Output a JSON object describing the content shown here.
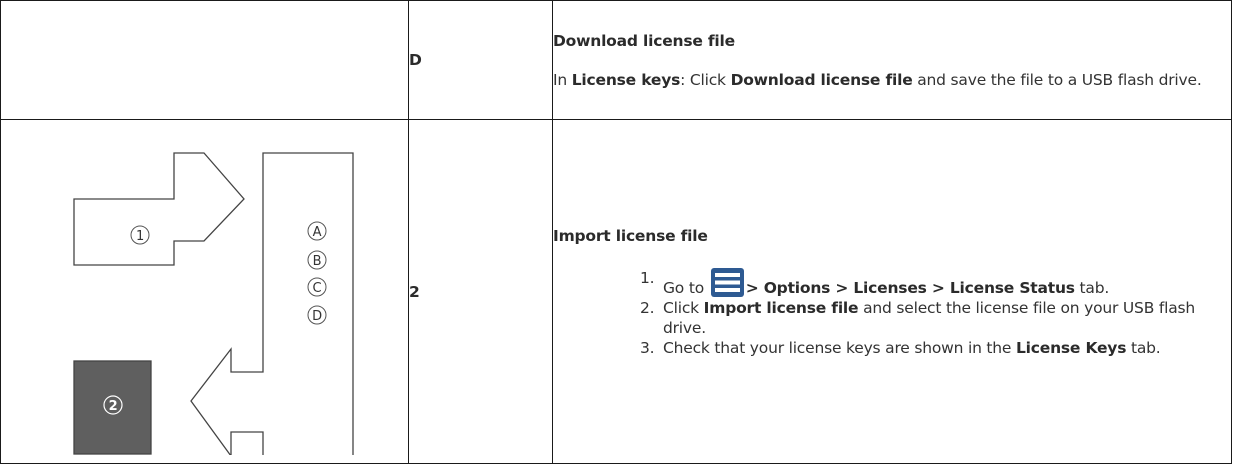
{
  "row_d": {
    "step_label": "D",
    "heading": "Download license file",
    "text_prefix": "In ",
    "text_bold1": "License keys",
    "text_mid": ": Click ",
    "text_bold2": "Download license file",
    "text_suffix": " and save the file to a USB flash drive."
  },
  "row_2": {
    "step_label": "2",
    "heading": "Import license file",
    "steps": [
      {
        "num": "1.",
        "pre": "Go to ",
        "bold": "> Options > Licenses > License Status",
        "post": " tab."
      },
      {
        "num": "2.",
        "pre": "Click ",
        "bold": "Import license file",
        "post": " and select the license file on your USB flash drive."
      },
      {
        "num": "3.",
        "pre": "Check that your license keys are shown in the ",
        "bold": "License Keys",
        "post": " tab."
      }
    ]
  },
  "diagram": {
    "labels": [
      "1",
      "A",
      "B",
      "C",
      "D",
      "2"
    ]
  },
  "icons": {
    "menu": "hamburger-menu-icon"
  },
  "colors": {
    "menu_icon": "#2e5a92",
    "dark_box": "#5f5f5f"
  }
}
